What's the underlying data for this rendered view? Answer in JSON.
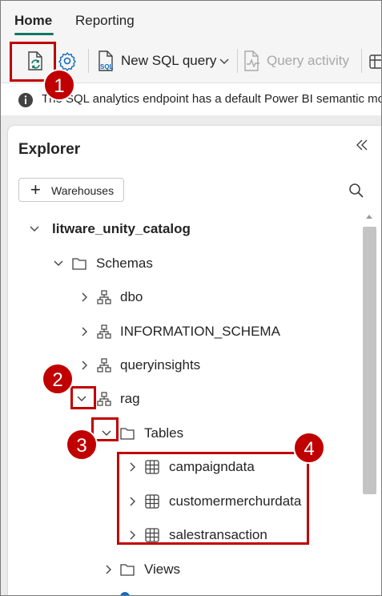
{
  "ribbon": {
    "tabs": [
      {
        "label": "Home",
        "active": true
      },
      {
        "label": "Reporting",
        "active": false
      }
    ],
    "accent_color": "#117865"
  },
  "toolbar": {
    "refresh_icon": "refresh-icon",
    "settings_icon": "gear-icon",
    "new_sql_query_label": "New SQL query",
    "query_activity_label": "Query activity"
  },
  "infobar": {
    "text": "The SQL analytics endpoint has a default Power BI semantic mo"
  },
  "explorer": {
    "title": "Explorer",
    "warehouses_button": "Warehouses",
    "tree": {
      "catalog": "litware_unity_catalog",
      "schemas_label": "Schemas",
      "schemas": [
        "dbo",
        "INFORMATION_SCHEMA",
        "queryinsights",
        "rag"
      ],
      "tables_label": "Tables",
      "tables": [
        "campaigndata",
        "customermerchurdata",
        "salestransaction"
      ],
      "views_label": "Views"
    }
  },
  "annotations": {
    "color": "#c00000",
    "numbers": [
      "1",
      "2",
      "3",
      "4"
    ]
  }
}
